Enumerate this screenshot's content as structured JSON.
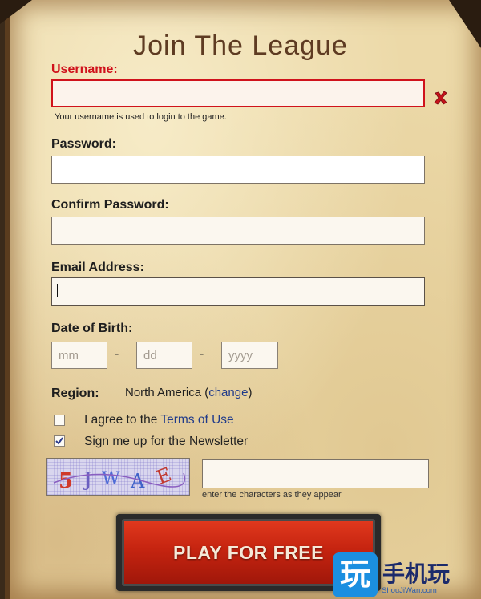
{
  "form": {
    "title": "Join The League",
    "username": {
      "label": "Username:",
      "value": "",
      "hint": "Your username is used to login to the game."
    },
    "password": {
      "label": "Password:",
      "value": ""
    },
    "confirm_password": {
      "label": "Confirm Password:",
      "value": ""
    },
    "email": {
      "label": "Email Address:",
      "value": ""
    },
    "dob": {
      "label": "Date of Birth:",
      "month_placeholder": "mm",
      "day_placeholder": "dd",
      "year_placeholder": "yyyy",
      "separator": "-"
    },
    "region": {
      "label": "Region:",
      "value": "North America",
      "open_paren": " (",
      "change_link": "change",
      "close_paren": ")"
    },
    "terms": {
      "checked": false,
      "text": "I agree to the ",
      "link": "Terms of Use"
    },
    "newsletter": {
      "checked": true,
      "text": "Sign me up for the Newsletter"
    },
    "captcha": {
      "image_text": "5JWAE",
      "value": "",
      "hint": "enter the characters as they appear"
    },
    "submit_label": "PLAY FOR FREE"
  },
  "watermark": {
    "icon_char": "玩",
    "text": "手机玩",
    "sub": "ShouJiWan.com"
  },
  "colors": {
    "parchment": "#ecd9a8",
    "title": "#5e3b22",
    "error": "#d0121c",
    "link": "#1f3a8a",
    "button": "#c52410"
  }
}
